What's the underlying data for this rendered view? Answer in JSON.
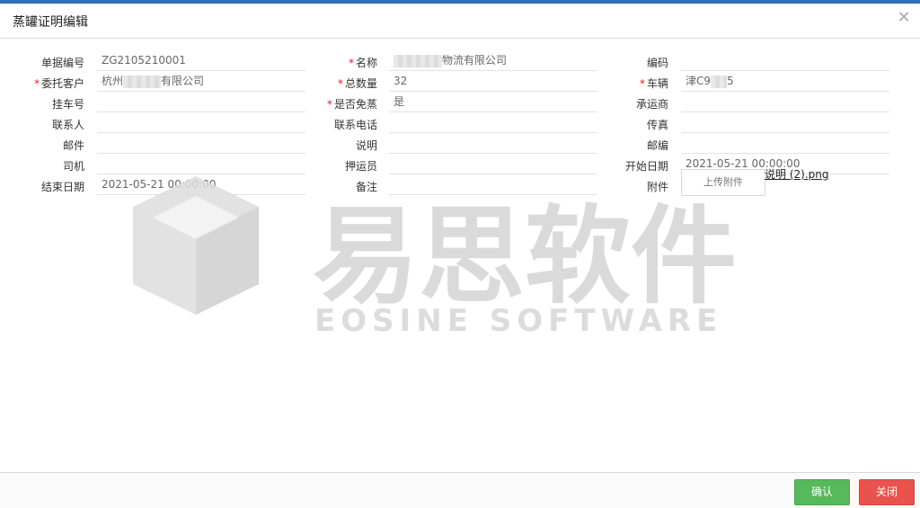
{
  "dialog": {
    "title": "蒸罐证明编辑",
    "close_icon": "close-icon"
  },
  "form": {
    "rows": [
      {
        "c1": {
          "label": "单据编号",
          "required": false,
          "value": "ZG2105210001"
        },
        "c2": {
          "label": "名称",
          "required": true,
          "value_suffix": "物流有限公司"
        },
        "c3": {
          "label": "编码",
          "required": false,
          "value": ""
        }
      },
      {
        "c1": {
          "label": "委托客户",
          "required": true,
          "value_prefix": "杭州",
          "value_suffix": "有限公司"
        },
        "c2": {
          "label": "总数量",
          "required": true,
          "value": "32"
        },
        "c3": {
          "label": "车辆",
          "required": true,
          "value_prefix": "津C9",
          "value_suffix": "5"
        }
      },
      {
        "c1": {
          "label": "挂车号",
          "required": false,
          "value": ""
        },
        "c2": {
          "label": "是否免蒸",
          "required": true,
          "value": "是"
        },
        "c3": {
          "label": "承运商",
          "required": false,
          "value": ""
        }
      },
      {
        "c1": {
          "label": "联系人",
          "required": false,
          "value": ""
        },
        "c2": {
          "label": "联系电话",
          "required": false,
          "value": ""
        },
        "c3": {
          "label": "传真",
          "required": false,
          "value": ""
        }
      },
      {
        "c1": {
          "label": "邮件",
          "required": false,
          "value": ""
        },
        "c2": {
          "label": "说明",
          "required": false,
          "value": ""
        },
        "c3": {
          "label": "邮编",
          "required": false,
          "value": ""
        }
      },
      {
        "c1": {
          "label": "司机",
          "required": false,
          "value": ""
        },
        "c2": {
          "label": "押运员",
          "required": false,
          "value": ""
        },
        "c3": {
          "label": "开始日期",
          "required": false,
          "value": "2021-05-21 00:00:00"
        }
      },
      {
        "c1": {
          "label": "结束日期",
          "required": false,
          "value": "2021-05-21 00:00:00"
        },
        "c2": {
          "label": "备注",
          "required": false,
          "value": ""
        },
        "c3": {
          "label": "附件",
          "required": false,
          "upload_label": "上传附件",
          "attachment_name": "说明 (2).png"
        }
      }
    ]
  },
  "watermark": {
    "cn": "易思软件",
    "en": "EOSINE SOFTWARE"
  },
  "footer": {
    "ok_label": "确认",
    "close_label": "关闭"
  },
  "colors": {
    "topbar": "#2f6fb8",
    "ok": "#58b85c",
    "close": "#e8534e",
    "required": "#e02020"
  }
}
